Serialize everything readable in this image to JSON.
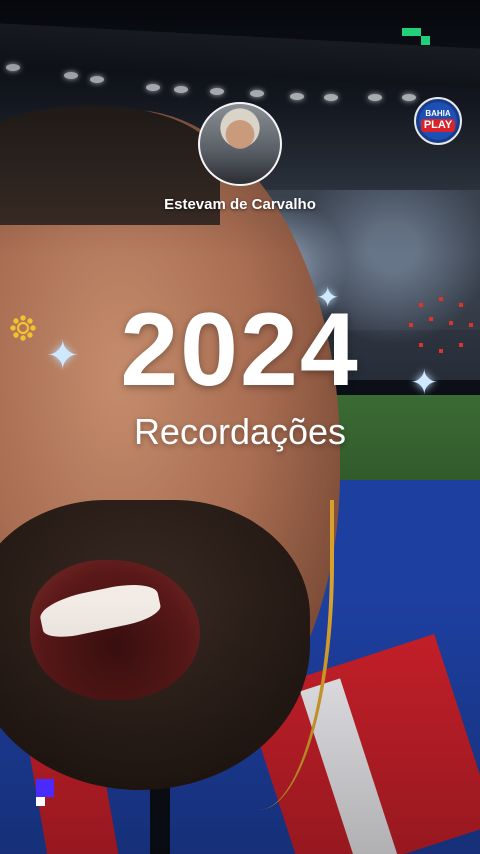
{
  "story": {
    "author_name": "Estevam de Carvalho",
    "year": "2024",
    "subtitle": "Recordações",
    "logo": {
      "line1": "BAHIA",
      "line2": "PLAY"
    }
  },
  "icons": {
    "sparkle": "four-point-star-icon",
    "sun": "sun-icon",
    "dots": "red-dots-icon",
    "pixel_marks": "pixel-block-icon"
  },
  "colors": {
    "text": "#ffffff",
    "sparkle": "#cfe8ff",
    "sun": "#f2c230",
    "green_accent": "#21d07a",
    "blue_accent": "#4a2bff",
    "red_dots": "#e0312b"
  }
}
